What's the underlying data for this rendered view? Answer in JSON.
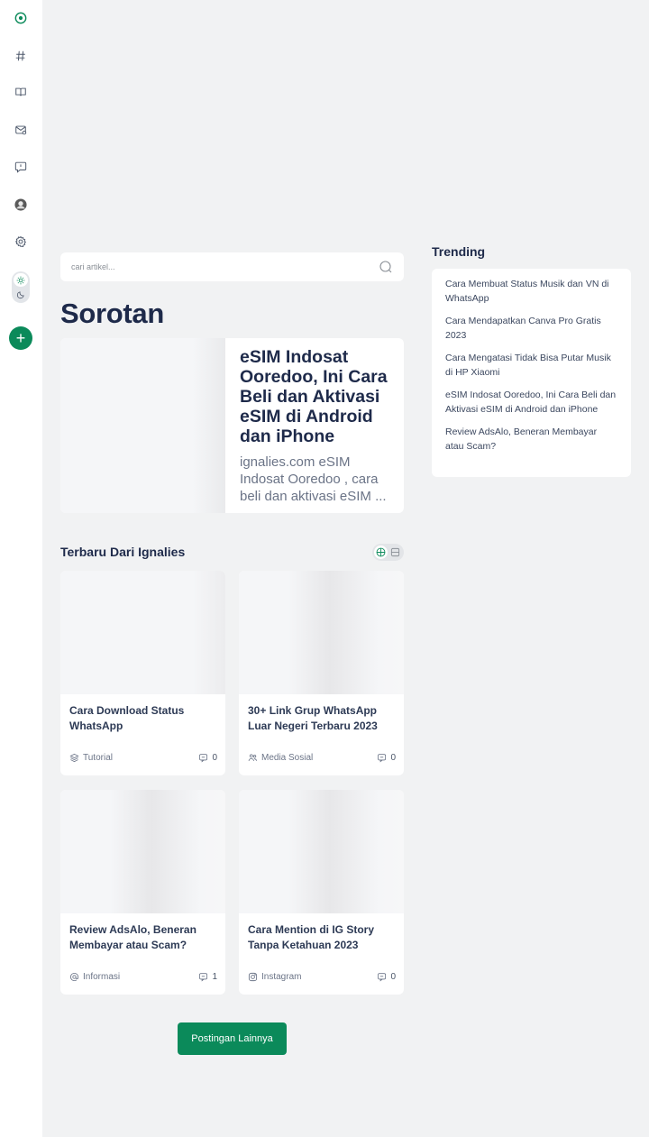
{
  "sidebar": {
    "items": [
      {
        "name": "logo-icon"
      },
      {
        "name": "hashtag-icon"
      },
      {
        "name": "book-icon"
      },
      {
        "name": "mail-icon"
      },
      {
        "name": "help-chat-icon"
      },
      {
        "name": "avatar"
      },
      {
        "name": "gear-icon"
      }
    ],
    "theme": {
      "light": "sun-icon",
      "dark": "moon-icon"
    },
    "add_label": "+"
  },
  "search": {
    "placeholder": "cari artikel..."
  },
  "page_title": "Sorotan",
  "featured": {
    "title": "eSIM Indosat Ooredoo, Ini Cara Beli dan Aktivasi eSIM di Android dan iPhone",
    "excerpt": "ignalies.com eSIM Indosat Ooredoo , cara beli dan aktivasi eSIM ..."
  },
  "latest": {
    "title": "Terbaru Dari Ignalies",
    "posts": [
      {
        "title": "Cara Download Status WhatsApp",
        "category": "Tutorial",
        "category_icon": "layers-icon",
        "comments": "0"
      },
      {
        "title": "30+ Link Grup WhatsApp Luar Negeri Terbaru 2023",
        "category": "Media Sosial",
        "category_icon": "users-icon",
        "comments": "0"
      },
      {
        "title": "Review AdsAlo, Beneran Membayar atau Scam?",
        "category": "Informasi",
        "category_icon": "at-icon",
        "comments": "1"
      },
      {
        "title": "Cara Mention di IG Story Tanpa Ketahuan 2023",
        "category": "Instagram",
        "category_icon": "instagram-icon",
        "comments": "0"
      }
    ],
    "more_label": "Postingan Lainnya"
  },
  "trending": {
    "title": "Trending",
    "items": [
      "Cara Membuat Status Musik dan VN di WhatsApp",
      "Cara Mendapatkan Canva Pro Gratis 2023",
      "Cara Mengatasi Tidak Bisa Putar Musik di HP Xiaomi",
      "eSIM Indosat Ooredoo, Ini Cara Beli dan Aktivasi eSIM di Android dan iPhone",
      "Review AdsAlo, Beneran Membayar atau Scam?"
    ]
  },
  "colors": {
    "accent": "#0b8a5a",
    "heading": "#1e2a4a",
    "background": "#f1f2f3"
  }
}
